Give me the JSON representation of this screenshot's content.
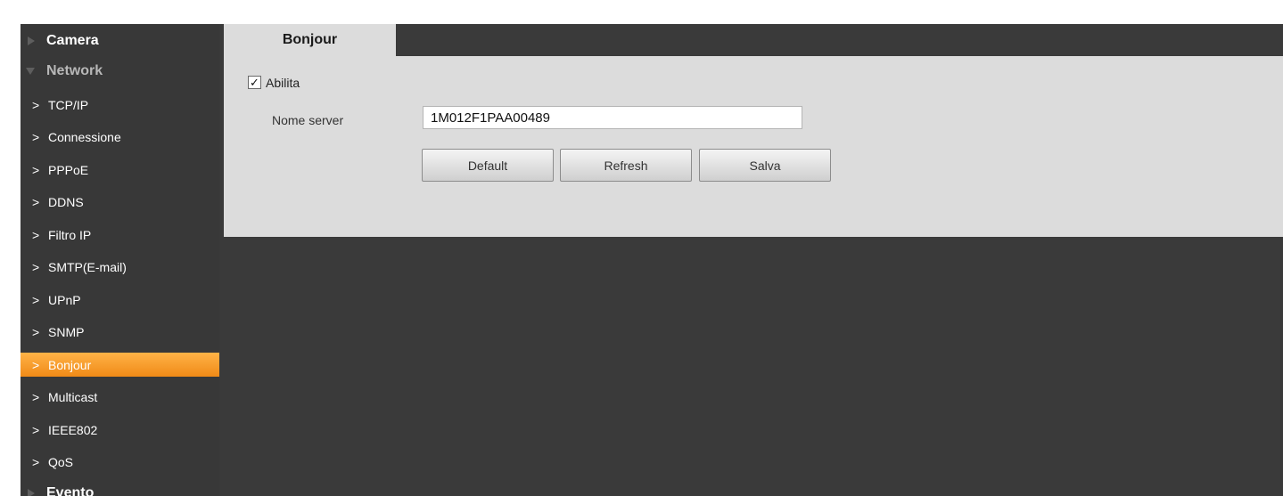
{
  "sidebar": {
    "top": {
      "camera": "Camera",
      "network": "Network",
      "evento": "Evento"
    },
    "sub_items": [
      {
        "label": "TCP/IP",
        "active": false
      },
      {
        "label": "Connessione",
        "active": false
      },
      {
        "label": "PPPoE",
        "active": false
      },
      {
        "label": "DDNS",
        "active": false
      },
      {
        "label": "Filtro IP",
        "active": false
      },
      {
        "label": "SMTP(E-mail)",
        "active": false
      },
      {
        "label": "UPnP",
        "active": false
      },
      {
        "label": "SNMP",
        "active": false
      },
      {
        "label": "Bonjour",
        "active": true
      },
      {
        "label": "Multicast",
        "active": false
      },
      {
        "label": "IEEE802",
        "active": false
      },
      {
        "label": "QoS",
        "active": false
      }
    ],
    "chevron_glyph": ">"
  },
  "tab": {
    "label": "Bonjour"
  },
  "form": {
    "enable_label": "Abilita",
    "enable_checked": true,
    "checkmark_glyph": "✓",
    "server_name_label": "Nome server",
    "server_name_value": "1M012F1PAA00489"
  },
  "buttons": {
    "default": "Default",
    "refresh": "Refresh",
    "save": "Salva"
  },
  "colors": {
    "active_item": "#f5941f",
    "background": "#3a3a3a",
    "panel": "#dcdcdc"
  }
}
